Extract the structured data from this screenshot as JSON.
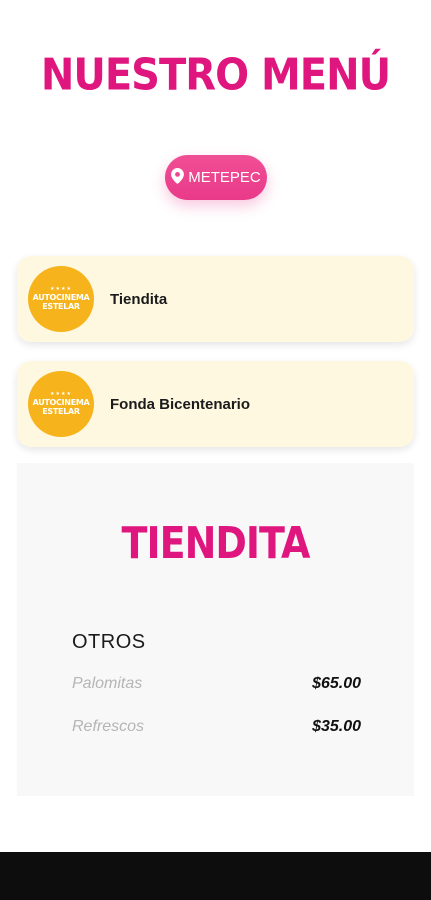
{
  "header": {
    "title": "NUESTRO MENÚ"
  },
  "location": {
    "label": "METEPEC",
    "icon": "map-pin-icon"
  },
  "vendors": [
    {
      "name": "Tiendita",
      "logo_line1": "AUTOCINEMA",
      "logo_line2": "ESTELAR",
      "logo_stars": "★★★★"
    },
    {
      "name": "Fonda Bicentenario",
      "logo_line1": "AUTOCINEMA",
      "logo_line2": "ESTELAR",
      "logo_stars": "★★★★"
    }
  ],
  "menu": {
    "title": "TIENDITA",
    "category": "OTROS",
    "items": [
      {
        "name": "Palomitas",
        "price": "$65.00"
      },
      {
        "name": "Refrescos",
        "price": "$35.00"
      }
    ]
  },
  "colors": {
    "accent": "#e0167f",
    "pill": "#ec4690",
    "card_background": "#fff8e1",
    "logo": "#f6b31b",
    "panel": "#f8f8f8",
    "nav_bar": "#0d0d0d"
  }
}
